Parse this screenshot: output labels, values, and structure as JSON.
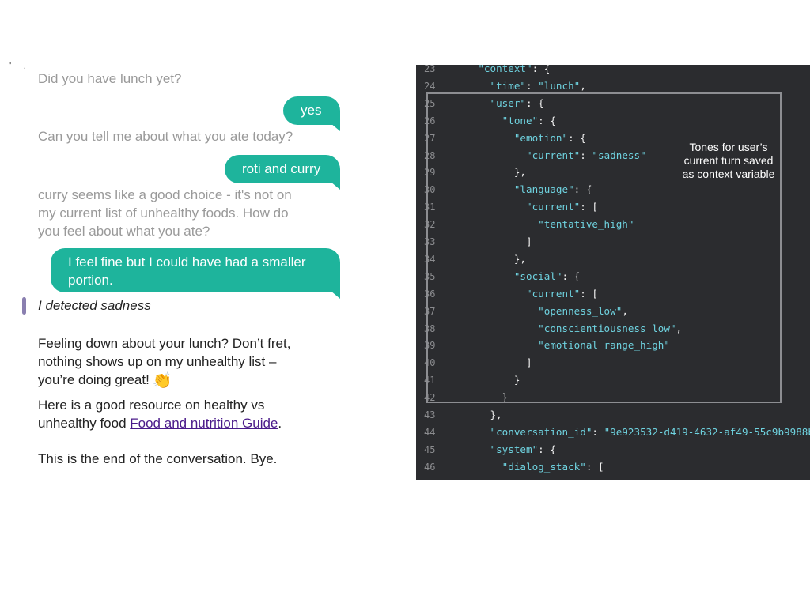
{
  "chat": {
    "stray_marks": "' ,",
    "messages_top": "Did you have lunch yet?",
    "user_yes": "yes",
    "bot_ask": "Can you tell me about what you ate today?",
    "user_roti": "roti and curry",
    "bot_curry_l1": "curry seems like a good choice - it's not on",
    "bot_curry_l2": "my current list of unhealthy foods. How do",
    "bot_curry_l3": "you feel about what you ate?",
    "user_fine_l1": "I feel fine but I could have had a smaller",
    "user_fine_l2": "portion.",
    "detected": "I detected sadness",
    "reply_l1": "Feeling down about your lunch? Don’t fret,",
    "reply_l2": "nothing shows up on my unhealthy list –",
    "reply_l3": "you’re doing great!",
    "reply_emoji": "👏",
    "resource_l1": "Here is a good resource on healthy vs",
    "resource_l2_prefix": "unhealthy food ",
    "resource_link": "Food and nutrition Guide",
    "resource_l2_suffix": ".",
    "bye": "This is the end of the conversation. Bye."
  },
  "code": {
    "note": [
      "Tones for user’s",
      "current turn saved",
      "as context variable"
    ],
    "lines": [
      {
        "n": "23",
        "indent": "    ",
        "parts": [
          [
            "k",
            "\"context\""
          ],
          [
            "p",
            ": {"
          ]
        ]
      },
      {
        "n": "24",
        "indent": "      ",
        "parts": [
          [
            "k",
            "\"time\""
          ],
          [
            "p",
            ": "
          ],
          [
            "s",
            "\"lunch\""
          ],
          [
            "p",
            ","
          ]
        ]
      },
      {
        "n": "25",
        "indent": "      ",
        "parts": [
          [
            "k",
            "\"user\""
          ],
          [
            "p",
            ": {"
          ]
        ]
      },
      {
        "n": "26",
        "indent": "        ",
        "parts": [
          [
            "k",
            "\"tone\""
          ],
          [
            "p",
            ": {"
          ]
        ]
      },
      {
        "n": "27",
        "indent": "          ",
        "parts": [
          [
            "k",
            "\"emotion\""
          ],
          [
            "p",
            ": {"
          ]
        ]
      },
      {
        "n": "28",
        "indent": "            ",
        "parts": [
          [
            "k",
            "\"current\""
          ],
          [
            "p",
            ": "
          ],
          [
            "s",
            "\"sadness\""
          ]
        ]
      },
      {
        "n": "29",
        "indent": "          ",
        "parts": [
          [
            "p",
            "},"
          ]
        ]
      },
      {
        "n": "30",
        "indent": "          ",
        "parts": [
          [
            "k",
            "\"language\""
          ],
          [
            "p",
            ": {"
          ]
        ]
      },
      {
        "n": "31",
        "indent": "            ",
        "parts": [
          [
            "k",
            "\"current\""
          ],
          [
            "p",
            ": ["
          ]
        ]
      },
      {
        "n": "32",
        "indent": "              ",
        "parts": [
          [
            "s",
            "\"tentative_high\""
          ]
        ]
      },
      {
        "n": "33",
        "indent": "            ",
        "parts": [
          [
            "p",
            "]"
          ]
        ]
      },
      {
        "n": "34",
        "indent": "          ",
        "parts": [
          [
            "p",
            "},"
          ]
        ]
      },
      {
        "n": "35",
        "indent": "          ",
        "parts": [
          [
            "k",
            "\"social\""
          ],
          [
            "p",
            ": {"
          ]
        ]
      },
      {
        "n": "36",
        "indent": "            ",
        "parts": [
          [
            "k",
            "\"current\""
          ],
          [
            "p",
            ": ["
          ]
        ]
      },
      {
        "n": "37",
        "indent": "              ",
        "parts": [
          [
            "s",
            "\"openness_low\""
          ],
          [
            "p",
            ","
          ]
        ]
      },
      {
        "n": "38",
        "indent": "              ",
        "parts": [
          [
            "s",
            "\"conscientiousness_low\""
          ],
          [
            "p",
            ","
          ]
        ]
      },
      {
        "n": "39",
        "indent": "              ",
        "parts": [
          [
            "s",
            "\"emotional range_high\""
          ]
        ]
      },
      {
        "n": "40",
        "indent": "            ",
        "parts": [
          [
            "p",
            "]"
          ]
        ]
      },
      {
        "n": "41",
        "indent": "          ",
        "parts": [
          [
            "p",
            "}"
          ]
        ]
      },
      {
        "n": "42",
        "indent": "        ",
        "parts": [
          [
            "p",
            "}"
          ]
        ]
      },
      {
        "n": "43",
        "indent": "      ",
        "parts": [
          [
            "p",
            "},"
          ]
        ]
      },
      {
        "n": "44",
        "indent": "      ",
        "parts": [
          [
            "k",
            "\"conversation_id\""
          ],
          [
            "p",
            ": "
          ],
          [
            "s",
            "\"9e923532-d419-4632-af49-55c9b9988b"
          ]
        ]
      },
      {
        "n": "45",
        "indent": "      ",
        "parts": [
          [
            "k",
            "\"system\""
          ],
          [
            "p",
            ": {"
          ]
        ]
      },
      {
        "n": "46",
        "indent": "        ",
        "parts": [
          [
            "k",
            "\"dialog_stack\""
          ],
          [
            "p",
            ": ["
          ]
        ]
      }
    ]
  },
  "colors": {
    "bubble": "#1eb49c",
    "code_bg": "#2b2c2f",
    "code_key": "#6fd3e0",
    "detected_bar": "#8a7fb0",
    "link": "#4a1a8a"
  }
}
